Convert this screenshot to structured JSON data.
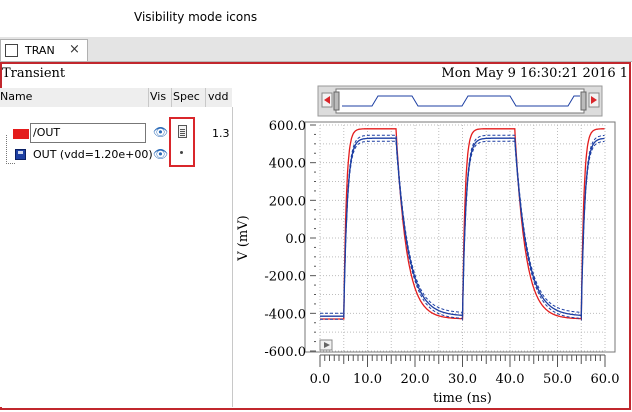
{
  "annotation": {
    "label": "Visibility mode icons",
    "color": "#d9262b"
  },
  "tab": {
    "label": "TRAN",
    "close": "×"
  },
  "panel": {
    "title": "Transient",
    "timestamp": "Mon May 9 16:30:21 2016  1"
  },
  "columns": {
    "name": "Name",
    "vis": "Vis",
    "spec": "Spec",
    "vdd": "vdd"
  },
  "signals": [
    {
      "name": "/OUT",
      "color": "#e41c1c",
      "vdd": "1.3",
      "vis_icon": "eye-icon",
      "spec_icon": "document-icon"
    },
    {
      "name": "OUT (vdd=1.20e+00)",
      "color": "#1d3fa3",
      "vis_icon": "eye-icon",
      "spec_icon": "dot-icon"
    }
  ],
  "chart_data": {
    "type": "line",
    "xlabel": "time (ns)",
    "ylabel": "V (mV)",
    "xlim": [
      0,
      60
    ],
    "ylim": [
      -600,
      600
    ],
    "xticks": [
      "0.0",
      "10.0",
      "20.0",
      "30.0",
      "40.0",
      "50.0",
      "60.0"
    ],
    "yticks": [
      "600.0",
      "400.0",
      "200.0",
      "0.0",
      "-200.0",
      "-400.0",
      "-600.0"
    ],
    "grid": true,
    "series": [
      {
        "name": "/OUT",
        "color": "#e41c1c",
        "low": -430,
        "high": 580
      },
      {
        "name": "OUT (vdd=1.20e+00)",
        "color": "#1d3fa3",
        "low": -415,
        "high": 530
      }
    ]
  }
}
